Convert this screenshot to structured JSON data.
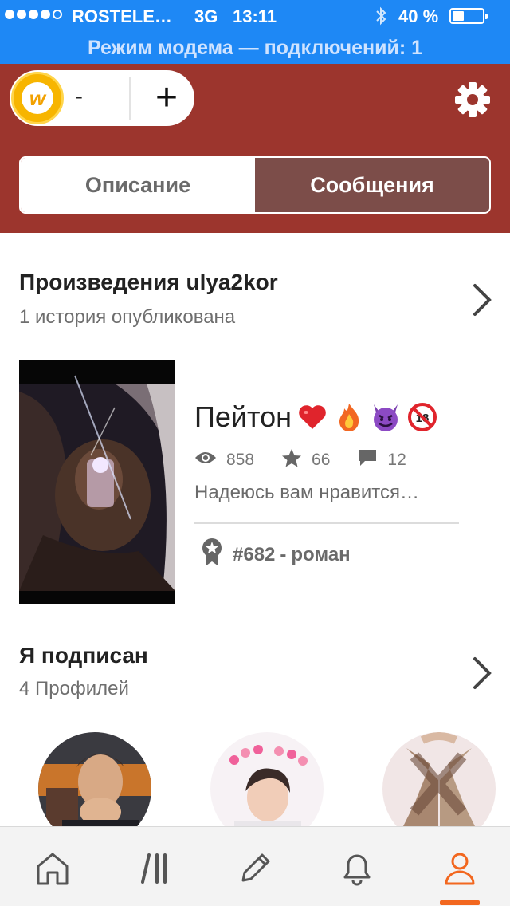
{
  "status_bar": {
    "carrier": "ROSTELE…",
    "network": "3G",
    "time": "13:11",
    "battery_percent": "40 %",
    "battery_level": 0.4,
    "signal_bars_filled": 4,
    "signal_bars_total": 5
  },
  "hotspot_banner": "Режим модема — подключений: 1",
  "header": {
    "coin_count": "-",
    "coin_letter": "w",
    "add_label": "+",
    "settings_icon": "gear-icon"
  },
  "tabs": [
    {
      "label": "Описание",
      "active": false
    },
    {
      "label": "Сообщения",
      "active": true
    }
  ],
  "works": {
    "title": "Произведения ulya2kor",
    "subtitle": "1 история опубликована",
    "story": {
      "title": "Пейтон",
      "emojis": [
        "red-heart",
        "fire",
        "smiling-imp",
        "no-one-under-eighteen"
      ],
      "views": "858",
      "votes": "66",
      "comments": "12",
      "description": "Надеюсь вам нравится…",
      "rank": "#682",
      "rank_separator": "-",
      "genre": "роман"
    }
  },
  "following": {
    "title": "Я подписан",
    "subtitle": "4 Профилей"
  },
  "bottom_nav": [
    {
      "icon": "home-icon",
      "active": false
    },
    {
      "icon": "library-icon",
      "active": false
    },
    {
      "icon": "pencil-icon",
      "active": false
    },
    {
      "icon": "bell-icon",
      "active": false
    },
    {
      "icon": "profile-icon",
      "active": true
    }
  ],
  "colors": {
    "status_blue": "#1e88f5",
    "header_red": "#9c352d",
    "active_tab": "#7c4d49",
    "accent_orange": "#f2671f"
  }
}
